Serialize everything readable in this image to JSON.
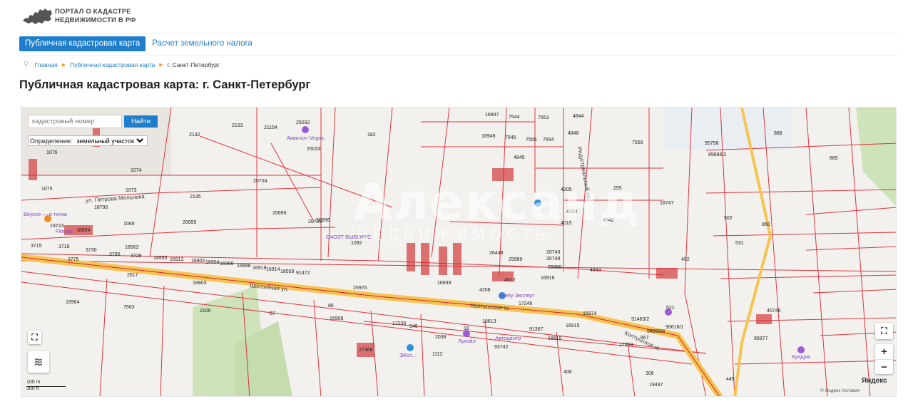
{
  "header": {
    "logo_line1": "ПОРТАЛ О КАДАСТРЕ",
    "logo_line2": "НЕДВИЖИМОСТИ В РФ"
  },
  "nav": {
    "tabs": [
      {
        "label": "Публичная кадастровая карта",
        "active": true
      },
      {
        "label": "Расчет земельного налога",
        "active": false
      }
    ]
  },
  "breadcrumb": {
    "items": [
      "Главная",
      "Публичная кадастровая карта"
    ],
    "current": "г. Санкт-Петербург"
  },
  "page": {
    "title": "Публичная кадастровая карта: г. Санкт-Петербург"
  },
  "map": {
    "search_placeholder": "кадастровый номер",
    "search_button": "Найти",
    "definition_label": "Определение:",
    "definition_value": "земельный участок",
    "zoom_in": "+",
    "zoom_out": "−",
    "scale_top": "100 m",
    "scale_bottom": "300 ft",
    "provider": "Яндекс",
    "copyright": "© Яндекс Условия",
    "watermark": "Александ",
    "watermark_sub": "НЕДВИЖИМОСТЬ",
    "parcel_color": "#d9232e",
    "road_color": "#f6c453",
    "park_color": "#cfe3bb",
    "street_labels": [
      "ул. Петрова Мельника",
      "Шоссейная ул.",
      "Колтушское ш.",
      "Индустриальный пр.",
      "Колтушское ш."
    ],
    "poi_labels": [
      "Аквилон Vegas",
      "Fitness",
      "Вкусно — и точка",
      "САОЗТ ВЫБОРГС",
      "Geely Эксперт",
      "Лукойл",
      "Автоцентр",
      "Кундрю",
      "ЭКсп..."
    ],
    "parcel_numbers": [
      "182",
      "2132",
      "2133",
      "21154",
      "25032",
      "25033",
      "1076",
      "1074",
      "1073",
      "1075",
      "2135",
      "20704",
      "20696",
      "20695",
      "20705",
      "20696",
      "1092",
      "19724",
      "18804",
      "1069",
      "18562",
      "18790",
      "3715",
      "3716",
      "3730",
      "3785",
      "3728",
      "18555",
      "16912",
      "16902",
      "16904",
      "16906",
      "16898",
      "16918",
      "16914",
      "18559",
      "91472",
      "3775",
      "2617",
      "18803",
      "16964",
      "7563",
      "2166",
      "57",
      "16908",
      "17235",
      "86",
      "25976",
      "16939",
      "17246",
      "18613",
      "91367",
      "18615",
      "93742",
      "27368",
      "1112",
      "2038",
      "546",
      "18",
      "16947",
      "7544",
      "7553",
      "4844",
      "16948",
      "7545",
      "7555",
      "7554",
      "4846",
      "4845",
      "7559",
      "255",
      "4842",
      "4843",
      "16916",
      "20749",
      "25990",
      "20748",
      "25989",
      "4012",
      "26448",
      "4015",
      "4204",
      "4205",
      "4208",
      "15974",
      "16915",
      "91463/2",
      "90618/1",
      "94890/4",
      "867",
      "17669",
      "406",
      "308",
      "19437",
      "449",
      "95758",
      "89886/2",
      "18747",
      "502",
      "860",
      "531",
      "492",
      "521",
      "95877",
      "40746",
      "865",
      "888"
    ]
  }
}
